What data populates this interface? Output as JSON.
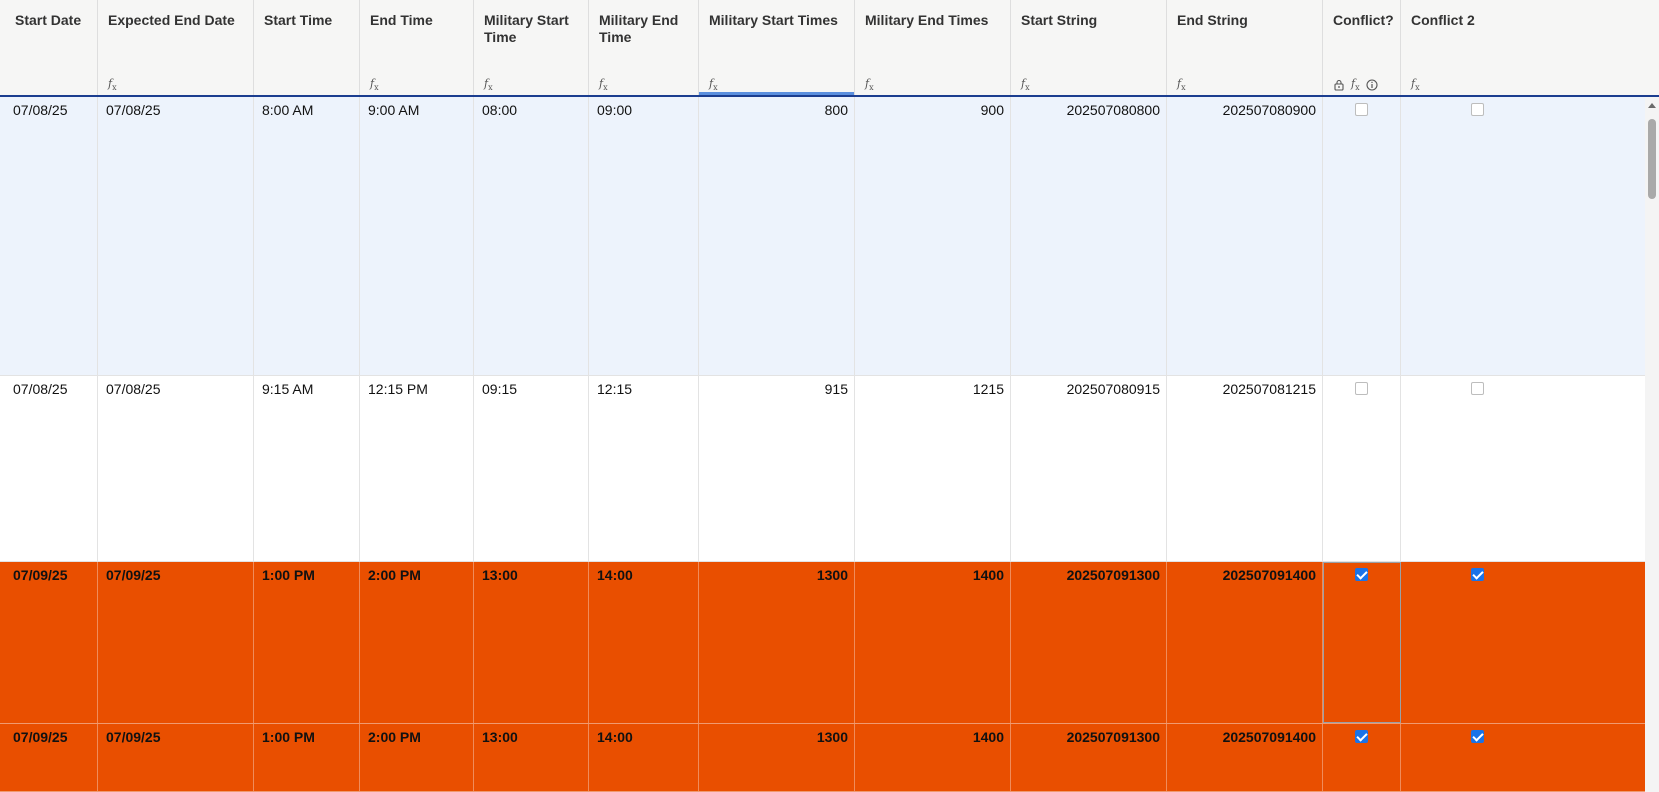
{
  "columns": [
    {
      "label": "Start Date",
      "fx": false
    },
    {
      "label": "Expected End Date",
      "fx": true
    },
    {
      "label": "Start Time",
      "fx": false
    },
    {
      "label": "End Time",
      "fx": true
    },
    {
      "label": "Military Start Time",
      "fx": true
    },
    {
      "label": "Military End Time",
      "fx": true
    },
    {
      "label": "Military Start Times",
      "fx": true
    },
    {
      "label": "Military End Times",
      "fx": true
    },
    {
      "label": "Start String",
      "fx": true
    },
    {
      "label": "End String",
      "fx": true
    },
    {
      "label": "Conflict?",
      "fx": true,
      "icons": [
        "lock-icon",
        "fx-icon",
        "info-icon"
      ]
    },
    {
      "label": "Conflict 2",
      "fx": true
    }
  ],
  "fx_symbol": "f",
  "fx_sub": "x",
  "rows": [
    {
      "style": "selected",
      "start_date": "07/08/25",
      "expected_end_date": "07/08/25",
      "start_time": "8:00 AM",
      "end_time": "9:00 AM",
      "military_start_time": "08:00",
      "military_end_time": "09:00",
      "military_start_times": "800",
      "military_end_times": "900",
      "start_string": "202507080800",
      "end_string": "202507080900",
      "conflict": false,
      "conflict2": false
    },
    {
      "style": "plain",
      "start_date": "07/08/25",
      "expected_end_date": "07/08/25",
      "start_time": "9:15 AM",
      "end_time": "12:15 PM",
      "military_start_time": "09:15",
      "military_end_time": "12:15",
      "military_start_times": "915",
      "military_end_times": "1215",
      "start_string": "202507080915",
      "end_string": "202507081215",
      "conflict": false,
      "conflict2": false
    },
    {
      "style": "conflict",
      "start_date": "07/09/25",
      "expected_end_date": "07/09/25",
      "start_time": "1:00 PM",
      "end_time": "2:00 PM",
      "military_start_time": "13:00",
      "military_end_time": "14:00",
      "military_start_times": "1300",
      "military_end_times": "1400",
      "start_string": "202507091300",
      "end_string": "202507091400",
      "conflict": true,
      "conflict2": true
    },
    {
      "style": "conflict",
      "start_date": "07/09/25",
      "expected_end_date": "07/09/25",
      "start_time": "1:00 PM",
      "end_time": "2:00 PM",
      "military_start_time": "13:00",
      "military_end_time": "14:00",
      "military_start_times": "1300",
      "military_end_times": "1400",
      "start_string": "202507091300",
      "end_string": "202507091400",
      "conflict": true,
      "conflict2": true
    }
  ],
  "colors": {
    "conflict_row": "#e94f00",
    "selected_row": "#edf3fc",
    "header_bg": "#f6f6f5",
    "header_border": "#1b3d8f",
    "checkbox_on": "#1a73e8"
  }
}
